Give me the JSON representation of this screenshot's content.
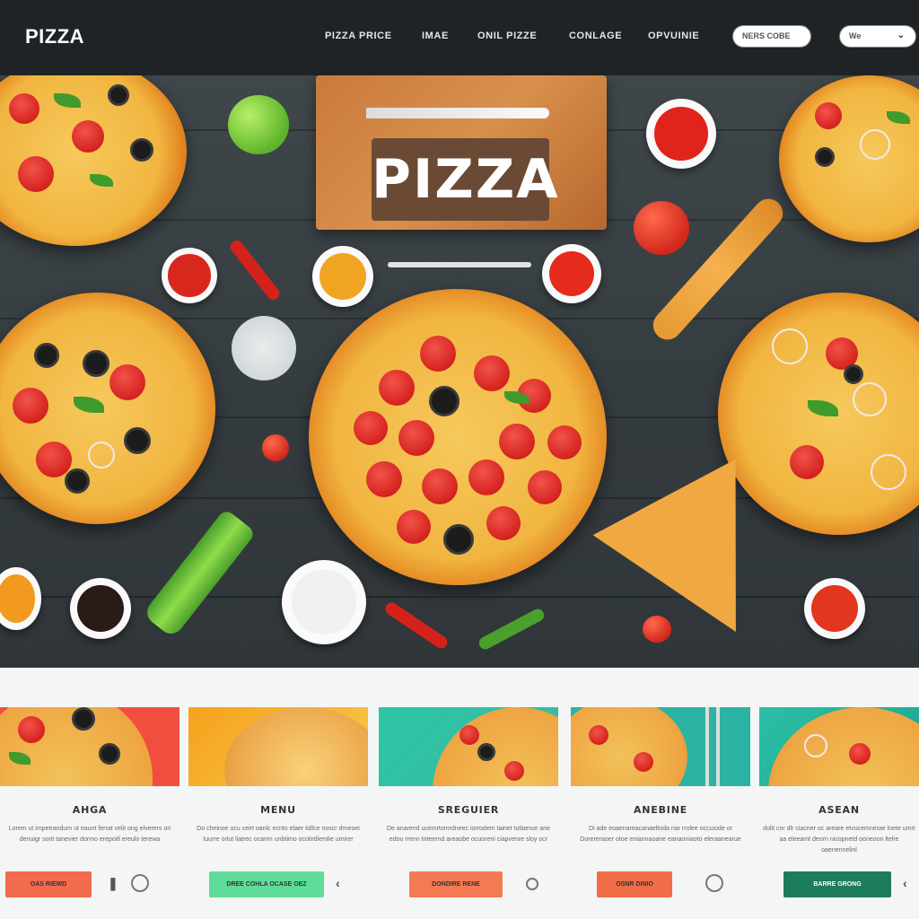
{
  "header": {
    "logo": "PIZZA",
    "nav": [
      "PIZZA PRICE",
      "IMAE",
      "ONIL PIZZE",
      "CONLAGE",
      "OPVUINIE"
    ],
    "search_value": "NERS COBE",
    "dropdown_value": "We"
  },
  "hero": {
    "board_title": "PIZZA"
  },
  "cards": [
    {
      "title": "AHGA",
      "desc": "Lorem ut impetrandum ut eaunt ferrat velit ong elverers on denuigr sorit tanevier dormo erepoitl ereulo terewa",
      "button": "OAS RIEWD",
      "color": "#f26b4c"
    },
    {
      "title": "MENU",
      "desc": "Do cheinoe ocu ceirt oanlc ecnto elaer tidlce noscr drneoei tuurre orlut liatrec ocanm unbtimo ocotirdiemlie umirer",
      "button": "DREE COHLA OCASE OEZ",
      "color": "#5fdc9a"
    },
    {
      "title": "SREGUIER",
      "desc": "De anarend ucemrtomrdneec iorrodem tainet tutlaesor ane edou rrenn tnteernd areaobe ocuoreni ciapvenre sloy ocr",
      "button": "DONDIRE RENE",
      "color": "#f47a53"
    },
    {
      "title": "ANEBINE",
      "desc": "Di ade eoaenareacanaeltoda nar rrolee occuiode or Dorereraoer otoe eniannaoane eanaoniaoto eleraanearue",
      "button": "OSNR DINIO",
      "color": "#f06d48"
    },
    {
      "title": "ASEAN",
      "desc": "dolit cnr dlr ciacner oc areare etvucemnerae lnete umrt aa eleeamt deorn nicopnetd ooneoon ltelre oaenennelinl",
      "button": "BARRE GRONG",
      "color": "#1e7c5e"
    }
  ]
}
